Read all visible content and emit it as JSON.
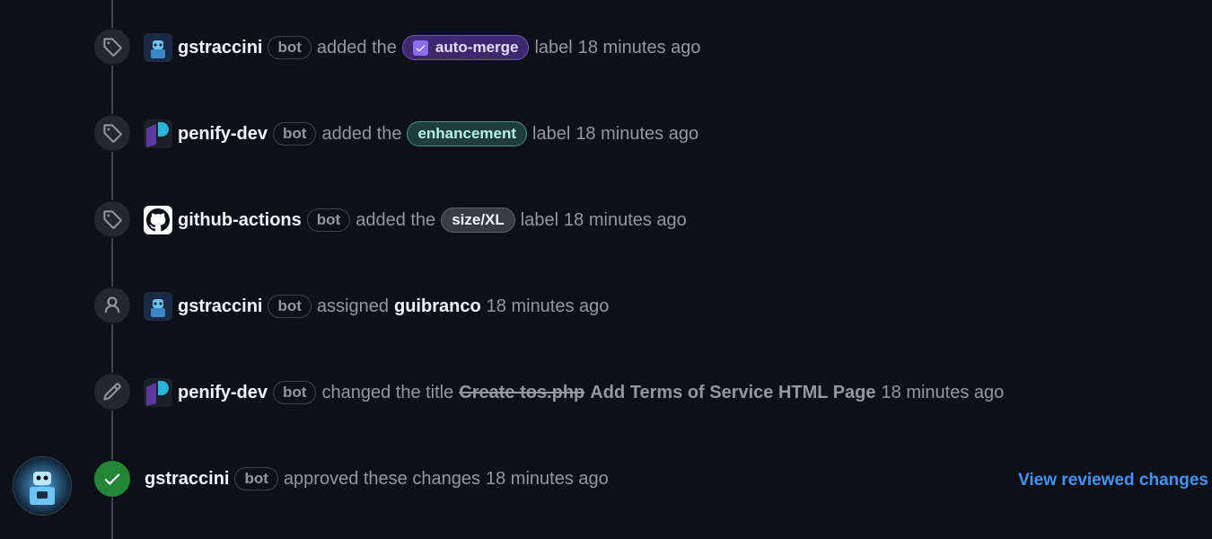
{
  "events": [
    {
      "icon": "tag-icon",
      "actor": "gstraccini",
      "bot": "bot",
      "verb": "added the",
      "label": "auto-merge",
      "suffix": "label",
      "time": "18 minutes ago"
    },
    {
      "icon": "tag-icon",
      "actor": "penify-dev",
      "bot": "bot",
      "verb": "added the",
      "label": "enhancement",
      "suffix": "label",
      "time": "18 minutes ago"
    },
    {
      "icon": "tag-icon",
      "actor": "github-actions",
      "bot": "bot",
      "verb": "added the",
      "label": "size/XL",
      "suffix": "label",
      "time": "18 minutes ago"
    },
    {
      "icon": "person-icon",
      "actor": "gstraccini",
      "bot": "bot",
      "verb": "assigned",
      "assignee": "guibranco",
      "time": "18 minutes ago"
    },
    {
      "icon": "pencil-icon",
      "actor": "penify-dev",
      "bot": "bot",
      "verb": "changed the title",
      "old_title": "Create tos.php",
      "new_title": "Add Terms of Service HTML Page",
      "time": "18 minutes ago"
    }
  ],
  "review": {
    "icon": "check-icon",
    "actor": "gstraccini",
    "bot": "bot",
    "verb": "approved these changes",
    "time": "18 minutes ago",
    "link": "View reviewed changes"
  },
  "colors": {
    "background": "#0d1117",
    "approved": "#238636",
    "link": "#4493f8"
  }
}
